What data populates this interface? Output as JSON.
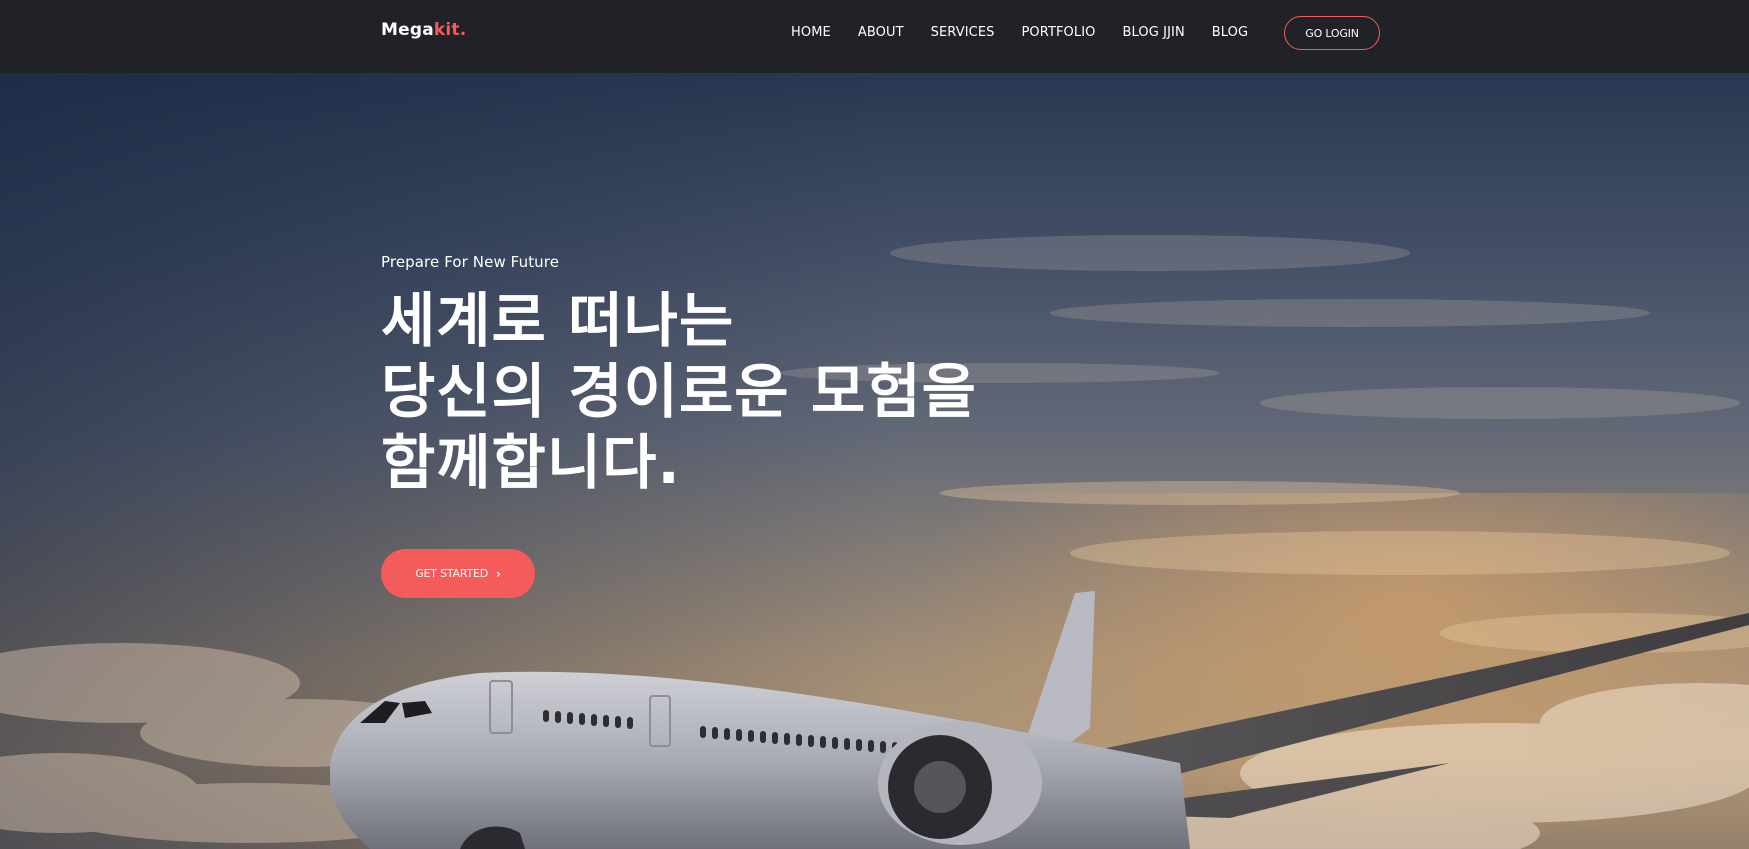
{
  "brand": {
    "logo_main": "Mega",
    "logo_accent": "kit."
  },
  "nav": {
    "items": [
      {
        "label": "HOME"
      },
      {
        "label": "ABOUT"
      },
      {
        "label": "SERVICES"
      },
      {
        "label": "PORTFOLIO"
      },
      {
        "label": "BLOG JJIN"
      },
      {
        "label": "BLOG"
      }
    ],
    "login_label": "GO LOGIN"
  },
  "hero": {
    "tagline": "Prepare For New Future",
    "headline_lines": [
      "세계로 떠나는",
      "당신의 경이로운 모험을",
      "함께합니다."
    ],
    "cta_label": "GET STARTED",
    "cta_icon": "chevron-right-icon",
    "background_image": "airplane-in-sunset-sky"
  },
  "colors": {
    "accent": "#f55a5a",
    "navbar_bg": "#212227",
    "text": "#ffffff"
  }
}
